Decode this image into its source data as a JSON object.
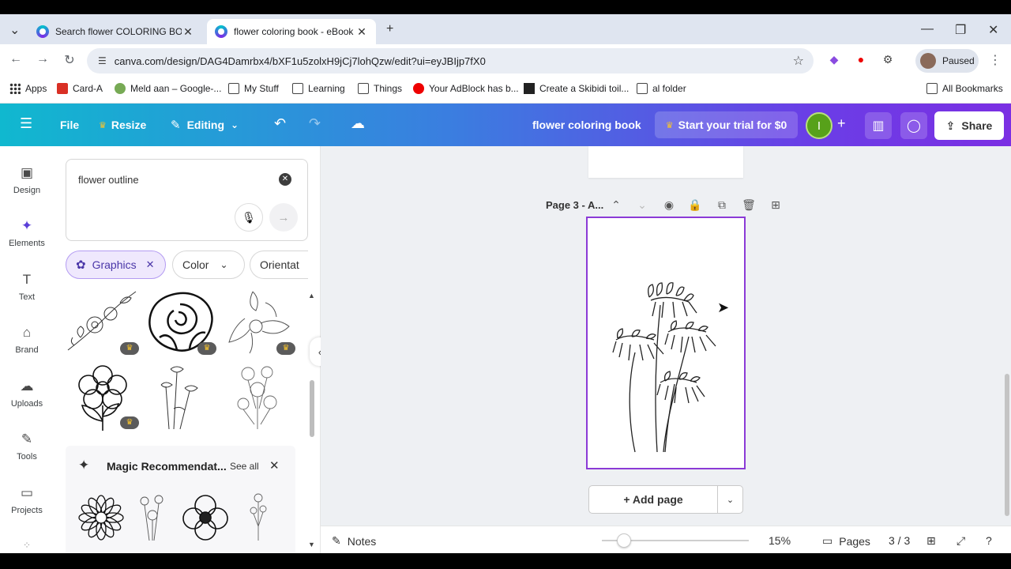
{
  "browser": {
    "tabs": [
      {
        "title": "Search flower COLORING BOOK",
        "active": false
      },
      {
        "title": "flower coloring book - eBook",
        "active": true
      }
    ],
    "url": "canva.com/design/DAG4Damrbx4/bXF1u5zolxH9jCj7lohQzw/edit?ui=eyJBIjp7fX0",
    "profile_status": "Paused",
    "bookmarks": [
      {
        "label": "Apps",
        "icon": "grid-icon"
      },
      {
        "label": "Card-A",
        "icon": "sk-icon"
      },
      {
        "label": "Meld aan – Google-...",
        "icon": "meld-icon"
      },
      {
        "label": "My Stuff",
        "icon": "folder-icon"
      },
      {
        "label": "Learning",
        "icon": "folder-icon"
      },
      {
        "label": "Things",
        "icon": "folder-icon"
      },
      {
        "label": "Your AdBlock has b...",
        "icon": "adblock-icon"
      },
      {
        "label": "Create a Skibidi toil...",
        "icon": "page-icon"
      },
      {
        "label": "al folder",
        "icon": "folder-icon"
      }
    ],
    "all_bookmarks": "All Bookmarks"
  },
  "canva_header": {
    "file": "File",
    "resize": "Resize",
    "editing": "Editing",
    "doc_title": "flower coloring book",
    "trial": "Start your trial for $0",
    "avatar_letter": "I",
    "share": "Share"
  },
  "rail": [
    {
      "label": "Design",
      "icon": "design-icon"
    },
    {
      "label": "Elements",
      "icon": "elements-icon",
      "active": true
    },
    {
      "label": "Text",
      "icon": "text-icon"
    },
    {
      "label": "Brand",
      "icon": "brand-icon"
    },
    {
      "label": "Uploads",
      "icon": "uploads-icon"
    },
    {
      "label": "Tools",
      "icon": "tools-icon"
    },
    {
      "label": "Projects",
      "icon": "projects-icon"
    }
  ],
  "panel": {
    "search_value": "flower outline",
    "chips": [
      "Graphics",
      "Color",
      "Orientat"
    ],
    "magic_title": "Magic Recommendat...",
    "see_all": "See all"
  },
  "workspace": {
    "page_label": "Page 3 - A...",
    "add_page": "+ Add page"
  },
  "bottom": {
    "notes": "Notes",
    "zoom": "15%",
    "pages": "Pages",
    "page_count": "3 / 3",
    "zoom_level": 0.1
  },
  "colors": {
    "canva_gradient_start": "#10b8cf",
    "canva_gradient_end": "#7b2fe3",
    "page_border": "#8b3ad6",
    "active_chip_bg": "#efe8fd"
  }
}
